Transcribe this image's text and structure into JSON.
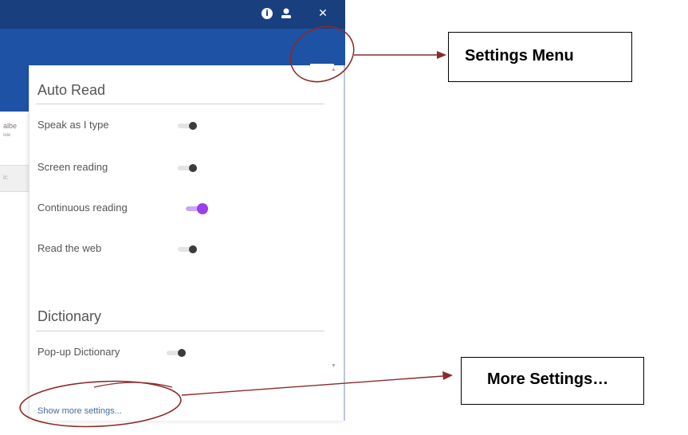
{
  "panel": {
    "auto_read": {
      "title": "Auto Read",
      "items": [
        {
          "label": "Speak as I type",
          "on": false
        },
        {
          "label": "Screen reading",
          "on": false
        },
        {
          "label": "Continuous reading",
          "on": true
        },
        {
          "label": "Read the web",
          "on": false
        }
      ]
    },
    "dictionary": {
      "title": "Dictionary",
      "items": [
        {
          "label": "Pop-up Dictionary",
          "on": false
        }
      ]
    },
    "more_link": "Show more settings..."
  },
  "background": {
    "text1": "albe",
    "text2": "iele",
    "field_text": "ic"
  },
  "callouts": {
    "settings_menu": "Settings Menu",
    "more_settings": "More Settings…"
  },
  "icons": {
    "info": "i",
    "user": "👤",
    "close": "✕"
  },
  "colors": {
    "topbar": "#1a3f7e",
    "toolbar": "#1e52a4",
    "toggle_on": "#9b3ee8",
    "annotation": "#8b2a2a"
  }
}
